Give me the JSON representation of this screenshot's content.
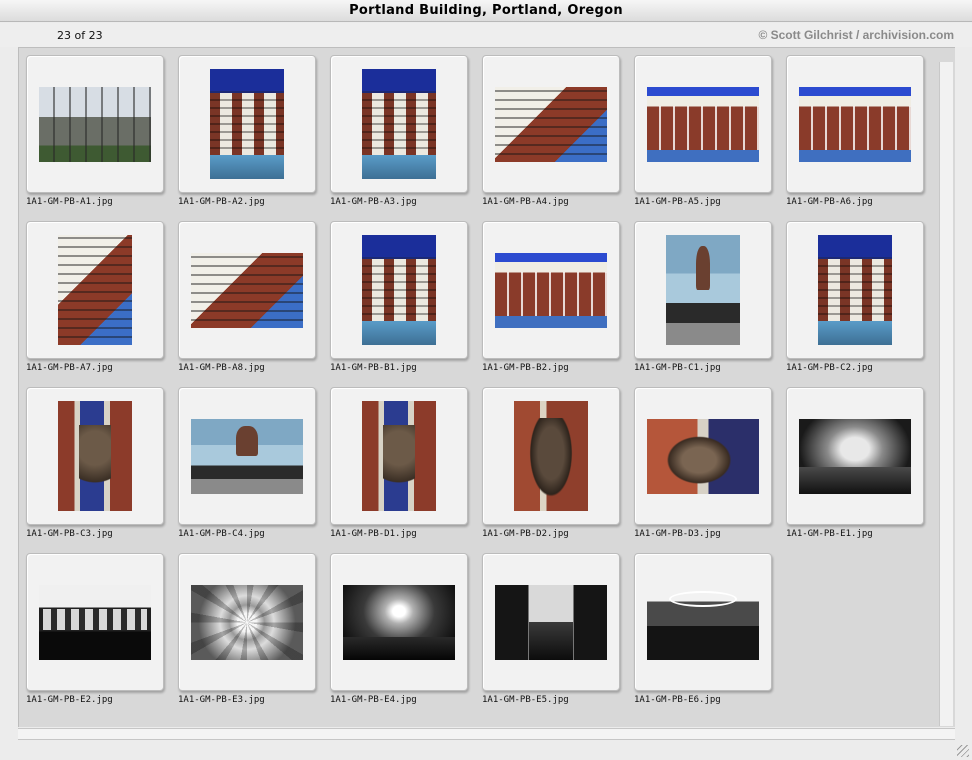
{
  "window": {
    "title": "Portland Building, Portland, Oregon",
    "counter": "23 of 23",
    "credit": "© Scott Gilchrist / archivision.com"
  },
  "slides": [
    {
      "name": "1A1-GM-PB-A1.jpg"
    },
    {
      "name": "1A1-GM-PB-A2.jpg"
    },
    {
      "name": "1A1-GM-PB-A3.jpg"
    },
    {
      "name": "1A1-GM-PB-A4.jpg"
    },
    {
      "name": "1A1-GM-PB-A5.jpg"
    },
    {
      "name": "1A1-GM-PB-A6.jpg"
    },
    {
      "name": "1A1-GM-PB-A7.jpg"
    },
    {
      "name": "1A1-GM-PB-A8.jpg"
    },
    {
      "name": "1A1-GM-PB-B1.jpg"
    },
    {
      "name": "1A1-GM-PB-B2.jpg"
    },
    {
      "name": "1A1-GM-PB-C1.jpg"
    },
    {
      "name": "1A1-GM-PB-C2.jpg"
    },
    {
      "name": "1A1-GM-PB-C3.jpg"
    },
    {
      "name": "1A1-GM-PB-C4.jpg"
    },
    {
      "name": "1A1-GM-PB-D1.jpg"
    },
    {
      "name": "1A1-GM-PB-D2.jpg"
    },
    {
      "name": "1A1-GM-PB-D3.jpg"
    },
    {
      "name": "1A1-GM-PB-E1.jpg"
    },
    {
      "name": "1A1-GM-PB-E2.jpg"
    },
    {
      "name": "1A1-GM-PB-E3.jpg"
    },
    {
      "name": "1A1-GM-PB-E4.jpg"
    },
    {
      "name": "1A1-GM-PB-E5.jpg"
    },
    {
      "name": "1A1-GM-PB-E6.jpg"
    }
  ]
}
